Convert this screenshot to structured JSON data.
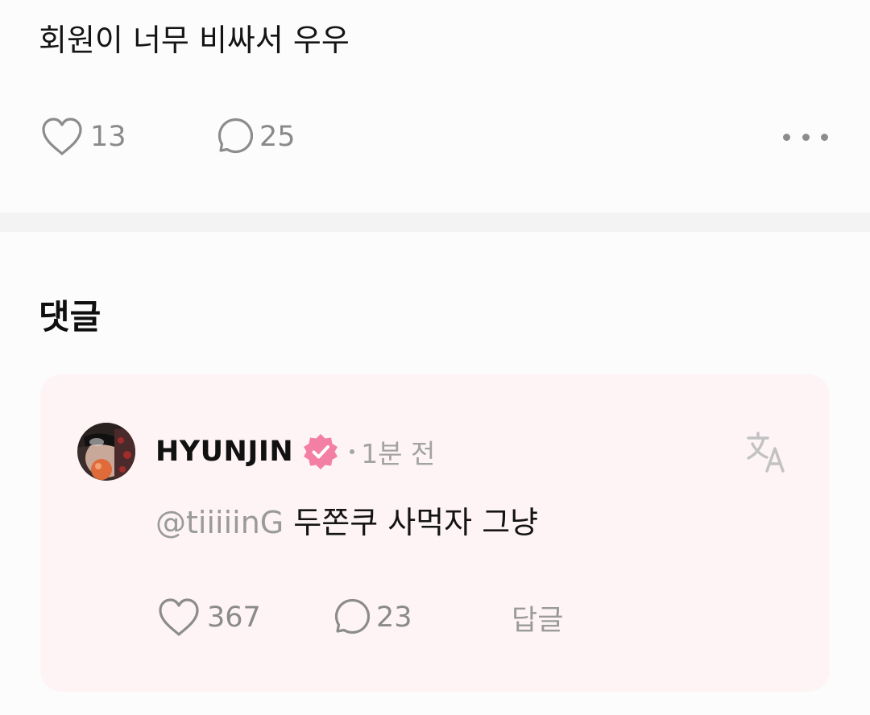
{
  "post": {
    "text": "회원이 너무 비싸서 우우",
    "like_count": "13",
    "comment_count": "25"
  },
  "comments_section": {
    "title": "댓글"
  },
  "comment": {
    "author": "HYUNJIN",
    "timestamp": "1분 전",
    "mention": "@tiiiiinG",
    "text": " 두쫀쿠 사먹자 그냥",
    "like_count": "367",
    "reply_count": "23",
    "reply_label": "답글"
  },
  "icons": {
    "like": "heart-outline-icon",
    "comment": "speech-bubble-icon",
    "more": "more-horizontal-icon",
    "verified": "verified-badge-icon",
    "translate": "translate-icon"
  },
  "colors": {
    "background": "#fcfcfc",
    "comment_card": "#fef4f6",
    "verified_badge": "#f47fa4",
    "muted_text": "#9a9a9a"
  }
}
